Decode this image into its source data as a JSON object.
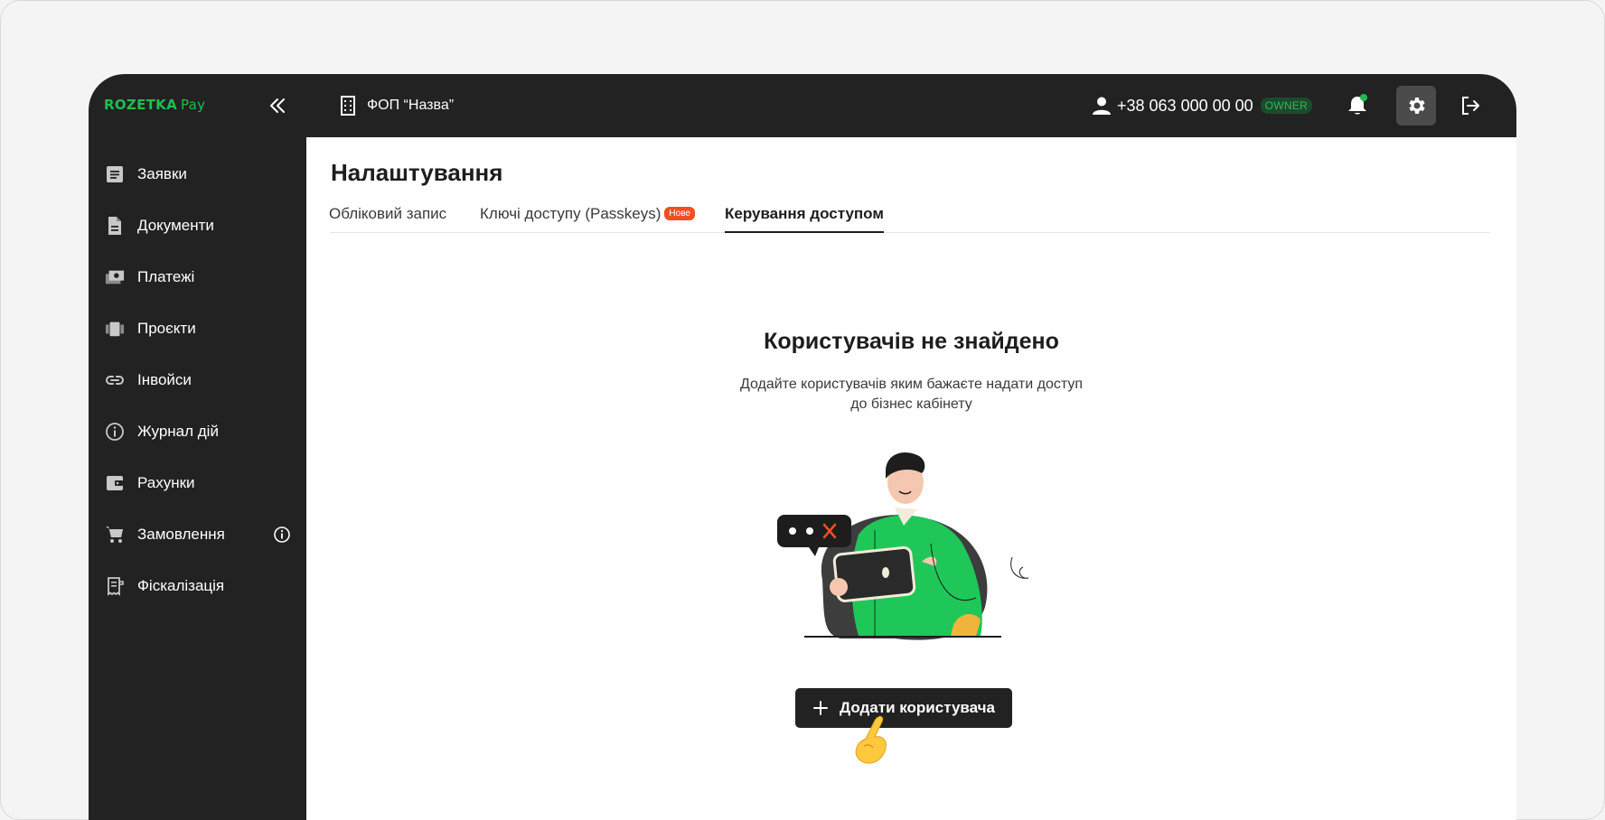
{
  "brand": {
    "name": "ROZETKA",
    "suffix": "Pay"
  },
  "header": {
    "company": "ФОП “Назва”",
    "phone": "+38 063 000 00 00",
    "role": "OWNER"
  },
  "sidebar": {
    "items": [
      {
        "label": "Заявки",
        "icon": "list-document-icon"
      },
      {
        "label": "Документи",
        "icon": "document-icon"
      },
      {
        "label": "Платежі",
        "icon": "payments-icon"
      },
      {
        "label": "Проєкти",
        "icon": "projects-icon"
      },
      {
        "label": "Інвойси",
        "icon": "link-icon"
      },
      {
        "label": "Журнал дій",
        "icon": "info-circle-icon"
      },
      {
        "label": "Рахунки",
        "icon": "wallet-icon"
      },
      {
        "label": "Замовлення",
        "icon": "cart-icon"
      },
      {
        "label": "Фіскалізація",
        "icon": "receipt-icon"
      }
    ]
  },
  "page": {
    "title": "Налаштування",
    "tabs": [
      {
        "label": "Обліковий запис"
      },
      {
        "label": "Ключі доступу (Passkeys)",
        "badge": "Нове"
      },
      {
        "label": "Керування доступом",
        "active": true
      }
    ]
  },
  "empty_state": {
    "title": "Користувачів не знайдено",
    "description_line1": "Додайте користувачів яким бажаєте надати доступ",
    "description_line2": "до бізнес кабінету",
    "button_label": "Додати користувача"
  },
  "colors": {
    "accent": "#1fbe4f",
    "dark": "#222222",
    "badge": "#f14f23"
  }
}
